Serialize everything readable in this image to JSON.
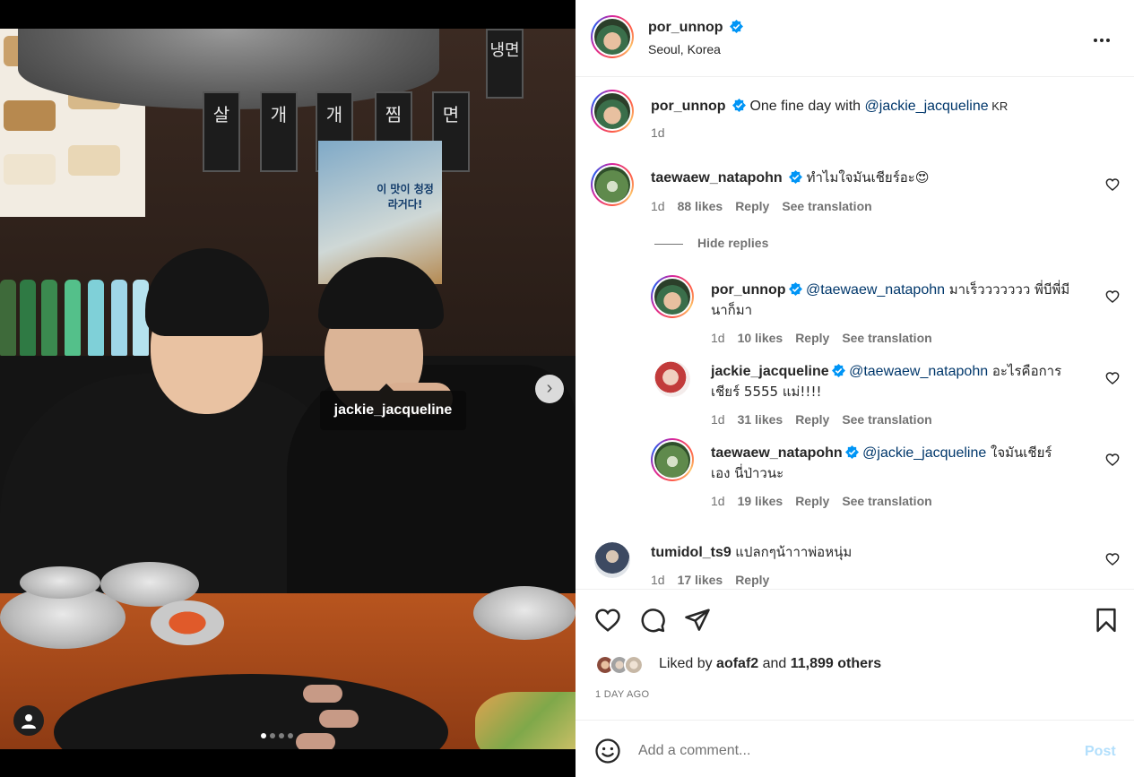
{
  "photo": {
    "tag_username": "jackie_jacqueline",
    "signs": [
      "살",
      "개",
      "개",
      "찜",
      "면",
      "냉면"
    ],
    "poster_text": "이 맛이 청정라거다!",
    "carousel": {
      "count": 4,
      "active": 0
    }
  },
  "post": {
    "author": "por_unnop",
    "location": "Seoul, Korea",
    "caption": {
      "username": "por_unnop",
      "text": "One fine day with ",
      "mention": "@jackie_jacqueline",
      "suffix": " KR",
      "time": "1d"
    },
    "liked_by_prefix": "Liked by ",
    "liked_by_user": "aofaf2",
    "liked_by_mid": " and ",
    "liked_by_others": "11,899 others",
    "age": "1 DAY AGO"
  },
  "comments": [
    {
      "username": "taewaew_natapohn",
      "verified": true,
      "text": "ทำไมใจมันเชียร์อะ😍",
      "time": "1d",
      "likes": "88 likes",
      "reply": "Reply",
      "translate": "See translation"
    },
    {
      "username": "tumidol_ts9",
      "verified": false,
      "text": "แปลกๆน้าาาพ่อหนุ่ม",
      "time": "1d",
      "likes": "17 likes",
      "reply": "Reply"
    }
  ],
  "hide_replies": "Hide replies",
  "replies": [
    {
      "username": "por_unnop",
      "mention": "@taewaew_natapohn",
      "text": " มาเร็ววววววว พี่บีพี่มี",
      "text2": "นาก็มา",
      "time": "1d",
      "likes": "10 likes",
      "reply": "Reply",
      "translate": "See translation"
    },
    {
      "username": "jackie_jacqueline",
      "mention": "@taewaew_natapohn",
      "text": " อะไรคือการ",
      "text2": "เชียร์ 5555 แม่!!!!",
      "time": "1d",
      "likes": "31 likes",
      "reply": "Reply",
      "translate": "See translation"
    },
    {
      "username": "taewaew_natapohn",
      "mention": "@jackie_jacqueline",
      "text": " ใจมันเชียร์",
      "text2": "เอง นี่ป่าวนะ",
      "time": "1d",
      "likes": "19 likes",
      "reply": "Reply",
      "translate": "See translation"
    }
  ],
  "composer": {
    "placeholder": "Add a comment...",
    "post_label": "Post"
  },
  "icons": [
    "heart-icon",
    "comment-icon",
    "share-icon",
    "bookmark-icon",
    "emoji-icon",
    "more-icon",
    "verified-icon",
    "user-tag-icon",
    "chevron-right-icon"
  ],
  "colors": {
    "link": "#00376b",
    "muted": "#737373",
    "verified": "#0095f6",
    "post_disabled": "#b2dffc"
  }
}
